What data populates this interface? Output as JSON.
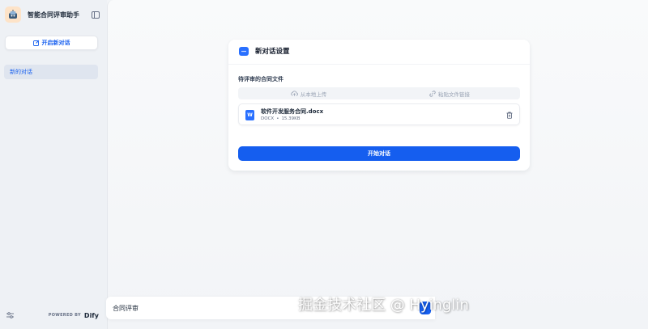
{
  "sidebar": {
    "app_title": "智能合同评审助手",
    "new_chat_label": "开启新对话",
    "conversations": [
      {
        "label": "新的对话"
      }
    ],
    "powered_by": "POWERED BY",
    "brand": "Dify"
  },
  "card": {
    "title": "新对话设置",
    "section_label": "待评审的合同文件",
    "upload_local_label": "从本地上传",
    "paste_link_label": "粘贴文件链接",
    "file": {
      "name": "软件开发服务合同.docx",
      "type": "DOCX",
      "separator": "•",
      "size": "15.39KB"
    },
    "start_label": "开始对话"
  },
  "chat_input": {
    "value": "合同评审"
  },
  "watermark": "掘金技术社区 @ Hyinglin",
  "colors": {
    "accent": "#155eef",
    "sidebar_bg": "#eef1f5",
    "active_item_bg": "#dfe5ef"
  },
  "icons": {
    "logo": "robot-avatar-icon",
    "collapse": "sidebar-collapse-icon",
    "new_chat": "edit-icon",
    "upload": "cloud-upload-icon",
    "link": "link-icon",
    "file": "docx-file-icon",
    "delete": "trash-icon",
    "settings": "settings-sliders-icon",
    "card": "chat-bubble-icon"
  }
}
